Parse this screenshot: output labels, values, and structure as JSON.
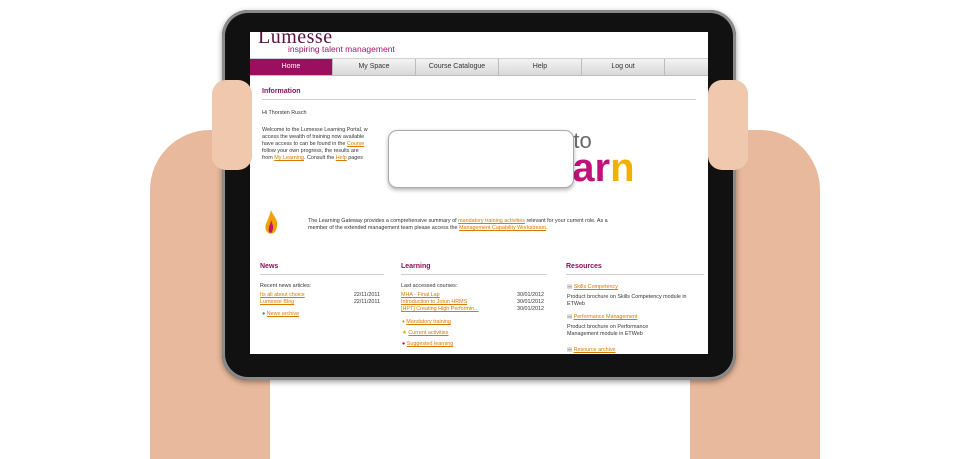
{
  "brand": {
    "logo": "Lumesse",
    "tagline": "inspiring talent management"
  },
  "nav": [
    {
      "label": "Home"
    },
    {
      "label": "My Space"
    },
    {
      "label": "Course Catalogue"
    },
    {
      "label": "Help"
    },
    {
      "label": "Log out"
    }
  ],
  "info": {
    "title": "Information",
    "greeting": "Hi Thorsten Rusch",
    "body_1": "Welcome to the Lumesse Learning Portal, w",
    "body_2": "access the wealth of training now available",
    "body_3a": "have access to can be found in the ",
    "body_3_link": "Course",
    "body_4": "follow your own progress, the results are",
    "body_5a": "from ",
    "body_5_link": "My Learning",
    "body_5b": ". Consult the ",
    "body_5_link2": "Help",
    "body_5c": " pages",
    "hero_to": "e to",
    "hero_learn_a": "ear",
    "hero_learn_b": "n",
    "gateway_1a": "The Learning Gateway provides a comprehensive summary of ",
    "gateway_link1": "mandatory training activities",
    "gateway_1b": " relevant for your current role. As a",
    "gateway_2a": "member of the extended management team please access the ",
    "gateway_link2": "Management Capability Workstream",
    "gateway_2b": "."
  },
  "news": {
    "title": "News",
    "subtitle": "Recent news articles:",
    "items": [
      {
        "label": "Its all about choice",
        "date": "22/11/2011"
      },
      {
        "label": "Lumesse Blog",
        "date": "22/11/2011"
      }
    ],
    "archive": "News archive"
  },
  "learning": {
    "title": "Learning",
    "subtitle": "Last accessed courses:",
    "items": [
      {
        "label": "MHA - Final Lap",
        "date": "30/01/2012"
      },
      {
        "label": "Introduction to Jotun HRMS",
        "date": "30/01/2012"
      },
      {
        "label": "[HPT] Creating High Performin...",
        "date": "30/01/2012"
      }
    ],
    "links": [
      "Mandatory training",
      "Current activities",
      "Suggested learning"
    ]
  },
  "resources": {
    "title": "Resources",
    "items": [
      {
        "label": "Skills Competency",
        "desc_1": "Product brochure on Skills Competency module in",
        "desc_2": "ETWeb"
      },
      {
        "label": "Performance Management",
        "desc_1": "Product brochure on Performance",
        "desc_2": "Management module in ETWeb"
      }
    ],
    "archive": "Resource archive"
  },
  "colors": {
    "accent": "#9b0f5f",
    "link": "#d87a00",
    "yellow": "#f2b000"
  }
}
